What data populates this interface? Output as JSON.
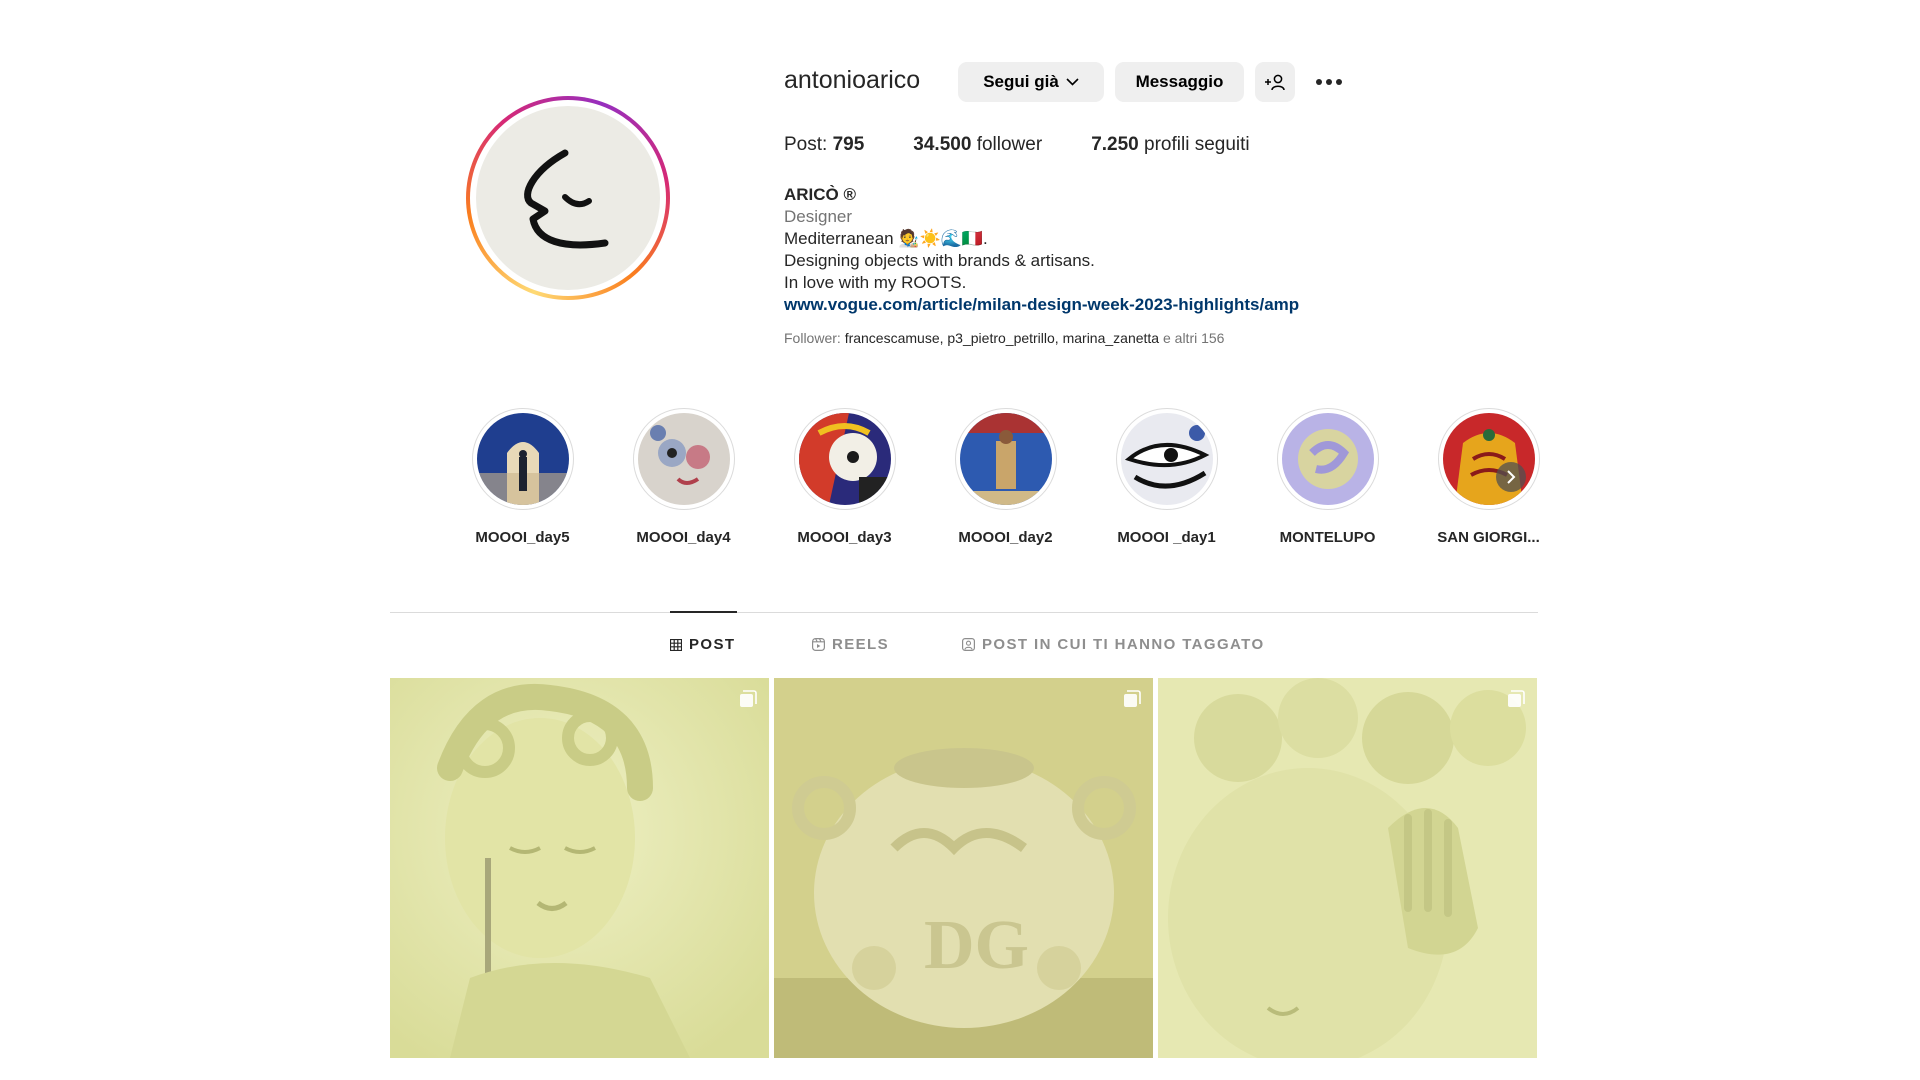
{
  "profile": {
    "username": "antonioarico",
    "follow_button_label": "Segui già",
    "message_button_label": "Messaggio",
    "add_user_icon": "+person-icon",
    "more_icon": "ellipsis-icon",
    "ring_colors": [
      "#feda75",
      "#fa7e1e",
      "#d62976",
      "#962fbf"
    ]
  },
  "stats": {
    "posts_label": "Post:",
    "posts_value": "795",
    "followers_value": "34.500",
    "followers_label": "follower",
    "following_value": "7.250",
    "following_label": "profili seguiti"
  },
  "bio": {
    "name": "ARICÒ ®",
    "category": "Designer",
    "line1": "Mediterranean 🧑‍🎨☀️🌊🇮🇹.",
    "line2": "Designing objects with brands & artisans.",
    "line3": "In love with my ROOTS.",
    "link": "www.vogue.com/article/milan-design-week-2023-highlights/amp"
  },
  "followed_by": {
    "prefix": "Follower: ",
    "names": "francescamuse, p3_pietro_petrillo, marina_zanetta",
    "suffix": " e altri 156"
  },
  "highlights": [
    {
      "label": "MOOOI_day5"
    },
    {
      "label": "MOOOI_day4"
    },
    {
      "label": "MOOOI_day3"
    },
    {
      "label": "MOOOI_day2"
    },
    {
      "label": "MOOOI _day1"
    },
    {
      "label": "MONTELUPO"
    },
    {
      "label": "SAN GIORGI..."
    }
  ],
  "tabs": {
    "post": "POST",
    "reels": "REELS",
    "tagged": "POST IN CUI TI HANNO TAGGATO"
  },
  "colors": {
    "link": "#00376b",
    "button_bg": "#efefef",
    "tile_tint": "#e3e4a8"
  }
}
